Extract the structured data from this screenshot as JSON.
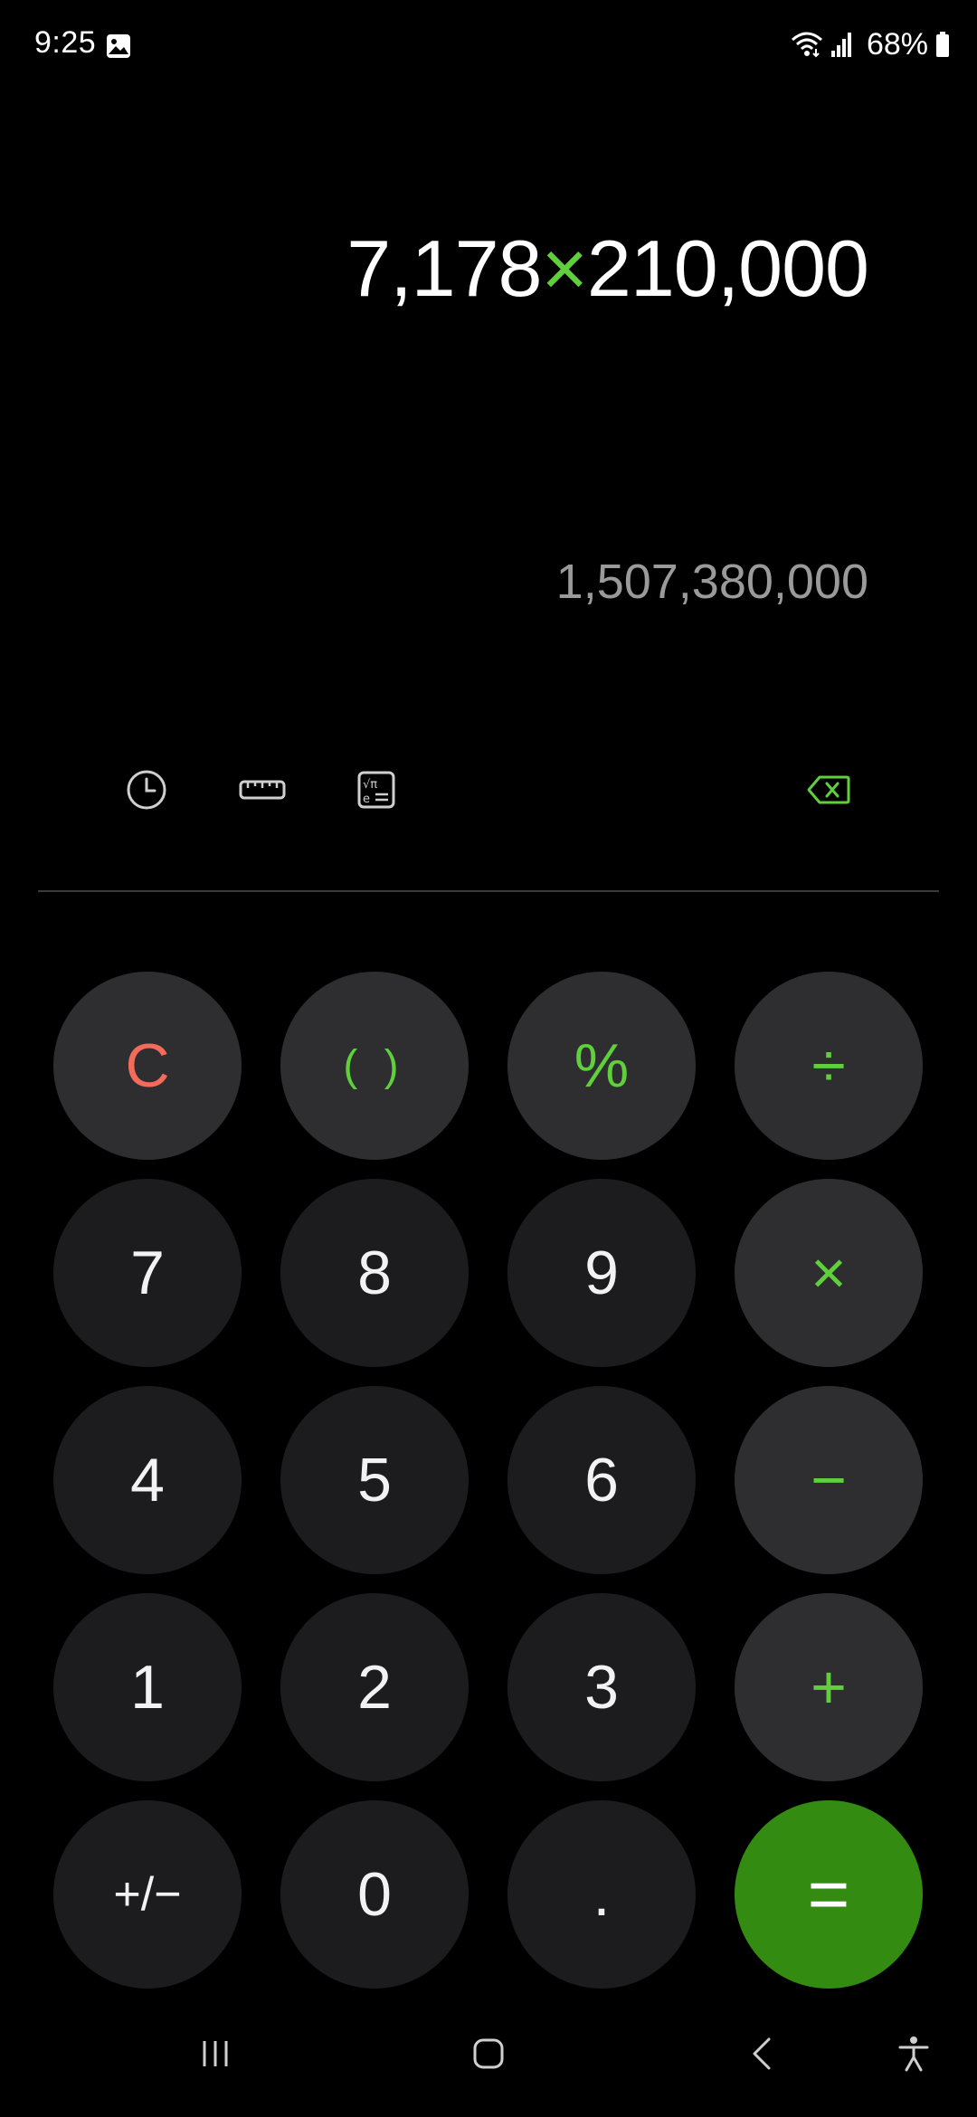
{
  "status_bar": {
    "time": "9:25",
    "battery": "68%",
    "icons": [
      "gallery-icon",
      "wifi-icon",
      "signal-icon",
      "battery-icon"
    ]
  },
  "display": {
    "operand1": "7,178",
    "operator": "×",
    "operand2": "210,000",
    "result": "1,507,380,000"
  },
  "toolbar": {
    "icons": [
      "history-icon",
      "unit-converter-icon",
      "scientific-icon",
      "backspace-icon"
    ]
  },
  "keys": {
    "clear": "C",
    "parentheses": "( )",
    "percent": "%",
    "divide": "÷",
    "seven": "7",
    "eight": "8",
    "nine": "9",
    "multiply": "×",
    "four": "4",
    "five": "5",
    "six": "6",
    "minus": "−",
    "one": "1",
    "two": "2",
    "three": "3",
    "plus": "+",
    "plus_minus": "+/−",
    "zero": "0",
    "decimal": ".",
    "equals": "="
  },
  "colors": {
    "accent_green": "#5fcf3c",
    "equals_bg": "#348b12",
    "clear_red": "#f26b5b",
    "digit_bg": "#1c1c1e",
    "function_bg": "#2e2e30"
  },
  "navbar": {
    "icons": [
      "recent-apps-icon",
      "home-icon",
      "back-icon",
      "accessibility-icon"
    ]
  }
}
